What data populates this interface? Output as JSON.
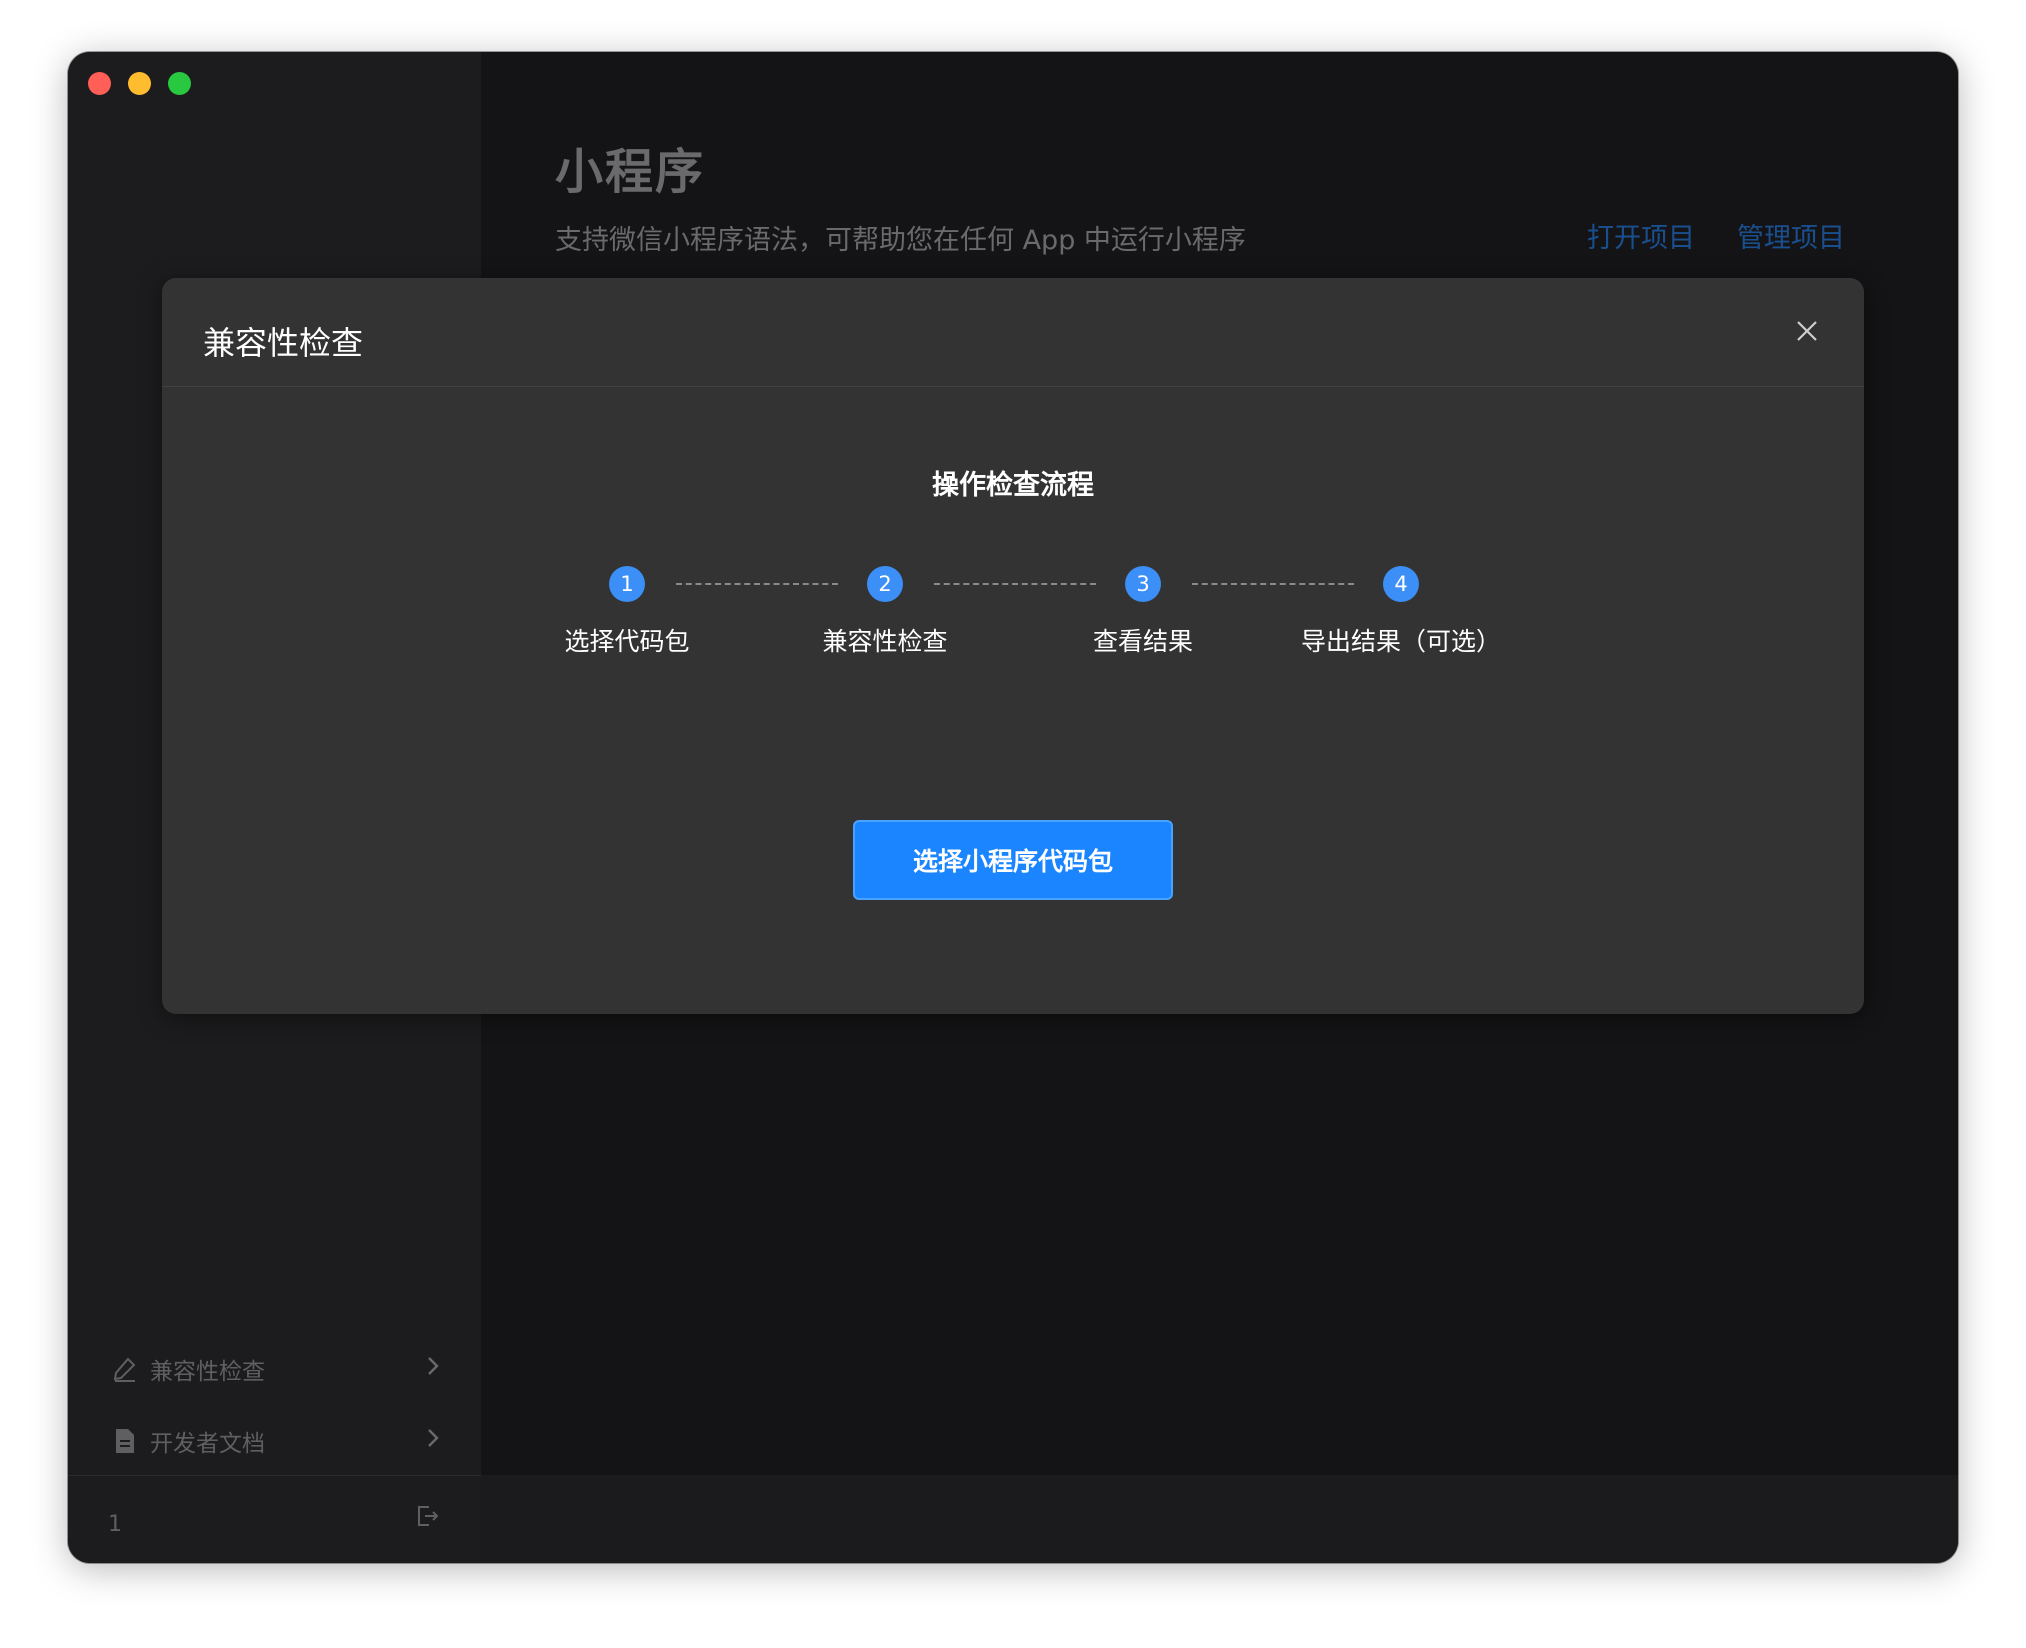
{
  "window": {
    "traffic_lights": [
      "close",
      "minimize",
      "zoom"
    ]
  },
  "sidebar": {
    "items": [
      {
        "label": "兼容性检查",
        "icon": "pen-icon"
      },
      {
        "label": "开发者文档",
        "icon": "document-icon"
      }
    ],
    "footer": {
      "user": "1",
      "logout_icon": "logout-icon"
    }
  },
  "main": {
    "title": "小程序",
    "subtitle": "支持微信小程序语法，可帮助您在任何 App 中运行小程序",
    "links": {
      "open_project": "打开项目",
      "manage_project": "管理项目"
    }
  },
  "modal": {
    "title": "兼容性检查",
    "flow_title": "操作检查流程",
    "steps": [
      {
        "number": "1",
        "label": "选择代码包"
      },
      {
        "number": "2",
        "label": "兼容性检查"
      },
      {
        "number": "3",
        "label": "查看结果"
      },
      {
        "number": "4",
        "label": "导出结果（可选）"
      }
    ],
    "primary_button": "选择小程序代码包"
  },
  "colors": {
    "accent": "#1a85ff",
    "step": "#3b8ff6",
    "link": "#1a4f8f",
    "modal_bg": "#333334",
    "window_bg": "#141416"
  }
}
